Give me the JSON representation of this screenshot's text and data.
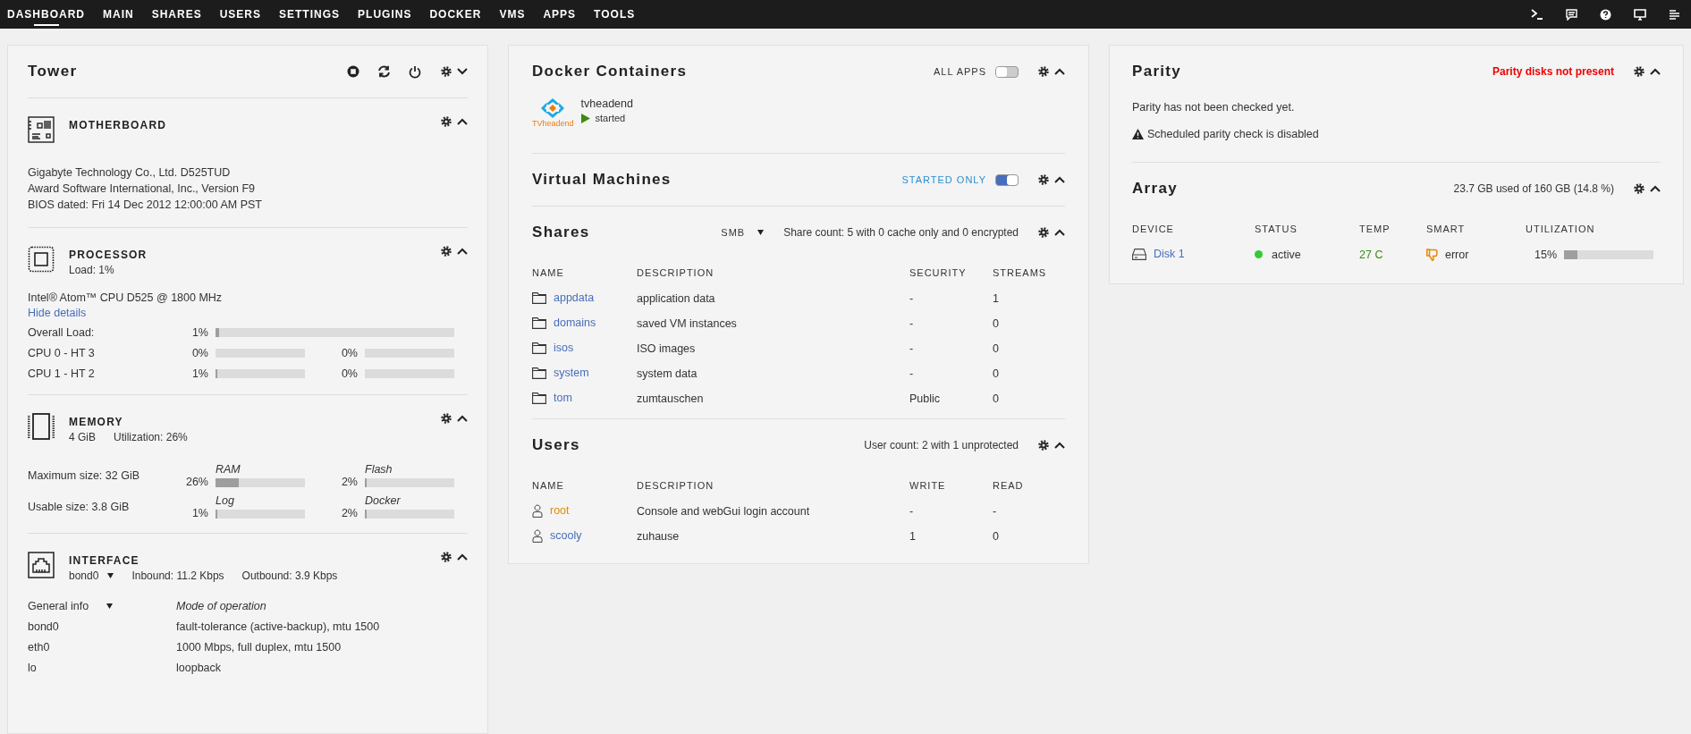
{
  "nav": {
    "items": [
      {
        "label": "DASHBOARD",
        "selected": true
      },
      {
        "label": "MAIN",
        "selected": false
      },
      {
        "label": "SHARES",
        "selected": false
      },
      {
        "label": "USERS",
        "selected": false
      },
      {
        "label": "SETTINGS",
        "selected": false
      },
      {
        "label": "PLUGINS",
        "selected": false
      },
      {
        "label": "DOCKER",
        "selected": false
      },
      {
        "label": "VMS",
        "selected": false
      },
      {
        "label": "APPS",
        "selected": false
      },
      {
        "label": "TOOLS",
        "selected": false
      }
    ]
  },
  "tower": {
    "title": "Tower",
    "motherboard": {
      "title": "MOTHERBOARD",
      "lines": [
        "Gigabyte Technology Co., Ltd. D525TUD",
        "Award Software International, Inc., Version F9",
        "BIOS dated: Fri 14 Dec 2012 12:00:00 AM PST"
      ]
    },
    "processor": {
      "title": "PROCESSOR",
      "load": "Load: 1%",
      "model": "Intel® Atom™ CPU D525 @ 1800 MHz",
      "details_link": "Hide details",
      "rows": [
        {
          "label": "Overall Load:",
          "cells": [
            {
              "value": "1%",
              "level": 0.01
            }
          ]
        },
        {
          "label": "CPU 0 - HT 3",
          "cells": [
            {
              "value": "0%",
              "level": 0
            },
            {
              "value": "0%",
              "level": 0
            }
          ]
        },
        {
          "label": "CPU 1 - HT 2",
          "cells": [
            {
              "value": "1%",
              "level": 0.01
            },
            {
              "value": "0%",
              "level": 0
            }
          ]
        }
      ]
    },
    "memory": {
      "title": "MEMORY",
      "size": "4 GiB",
      "utilization": "Utilization: 26%",
      "rows": [
        {
          "label": "Maximum size: 32 GiB",
          "gauges": [
            {
              "name": "RAM",
              "value": "26%",
              "level": 0.26
            },
            {
              "name": "Flash",
              "value": "2%",
              "level": 0.02
            }
          ]
        },
        {
          "label": "Usable size: 3.8 GiB",
          "gauges": [
            {
              "name": "Log",
              "value": "1%",
              "level": 0.01
            },
            {
              "name": "Docker",
              "value": "2%",
              "level": 0.02
            }
          ]
        }
      ]
    },
    "interface": {
      "title": "INTERFACE",
      "port": "bond0",
      "inbound": "Inbound: 11.2 Kbps",
      "outbound": "Outbound: 3.9 Kbps",
      "info_select": "General info",
      "info_heading": "Mode of operation",
      "rows": [
        {
          "name": "bond0",
          "value": "fault-tolerance (active-backup), mtu 1500"
        },
        {
          "name": "eth0",
          "value": "1000 Mbps, full duplex, mtu 1500"
        },
        {
          "name": "lo",
          "value": "loopback"
        }
      ]
    }
  },
  "docker": {
    "title": "Docker Containers",
    "toggle_label": "ALL APPS",
    "on": false,
    "containers": [
      {
        "name": "tvheadend",
        "logo_text": "TVheadend",
        "status": "started"
      }
    ]
  },
  "vms": {
    "title": "Virtual Machines",
    "toggle_label": "STARTED ONLY",
    "on": true
  },
  "shares": {
    "title": "Shares",
    "protocol": "SMB",
    "summary": "Share count: 5 with 0 cache only and 0 encrypted",
    "columns": [
      "NAME",
      "DESCRIPTION",
      "SECURITY",
      "STREAMS"
    ],
    "rows": [
      {
        "name": "appdata",
        "description": "application data",
        "security": "-",
        "streams": "1"
      },
      {
        "name": "domains",
        "description": "saved VM instances",
        "security": "-",
        "streams": "0"
      },
      {
        "name": "isos",
        "description": "ISO images",
        "security": "-",
        "streams": "0"
      },
      {
        "name": "system",
        "description": "system data",
        "security": "-",
        "streams": "0"
      },
      {
        "name": "tom",
        "description": "zumtauschen",
        "security": "Public",
        "streams": "0"
      }
    ]
  },
  "users": {
    "title": "Users",
    "summary": "User count: 2 with 1 unprotected",
    "columns": [
      "NAME",
      "DESCRIPTION",
      "WRITE",
      "READ"
    ],
    "rows": [
      {
        "name": "root",
        "color": "#e68a00",
        "description": "Console and webGui login account",
        "write": "-",
        "read": "-"
      },
      {
        "name": "scooly",
        "color": "#486dba",
        "description": "zuhause",
        "write": "1",
        "read": "0"
      }
    ]
  },
  "parity": {
    "title": "Parity",
    "alert": "Parity disks not present",
    "note": "Parity has not been checked yet.",
    "warning": "Scheduled parity check is disabled"
  },
  "array": {
    "title": "Array",
    "summary": "23.7 GB used of 160 GB (14.8 %)",
    "columns": [
      "DEVICE",
      "STATUS",
      "TEMP",
      "SMART",
      "UTILIZATION"
    ],
    "rows": [
      {
        "device": "Disk 1",
        "status": "active",
        "color": "#33cc33",
        "temp": "27 C",
        "smart": "error",
        "utilization": "15%",
        "level": 0.15
      }
    ]
  }
}
